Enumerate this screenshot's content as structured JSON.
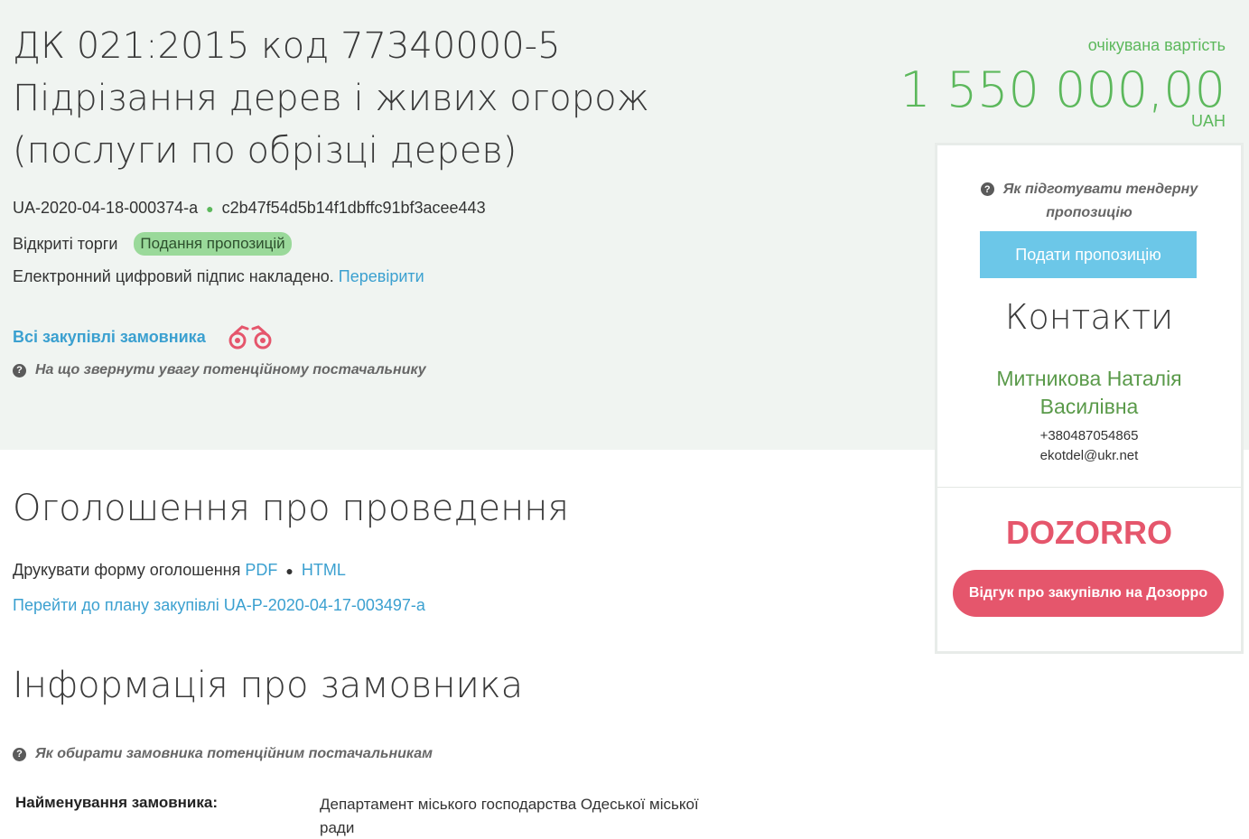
{
  "tender": {
    "title_line1": "ДК 021:2015 код 77340000-5",
    "title_line2": "Підрізання дерев і живих огорож",
    "title_line3": "(послуги по обрізці дерев)",
    "id": "UA-2020-04-18-000374-a",
    "id_separator": "●",
    "hash": "c2b47f54d5b14f1dbffc91bf3acee443",
    "procedure_type": "Відкриті торги",
    "status": "Подання пропозицій",
    "signature_text": "Електронний цифровий підпис накладено.",
    "signature_link": "Перевірити",
    "all_purchases_link": "Всі закупівлі замовника",
    "attention_help": "На що звернути увагу потенційному постачальнику"
  },
  "value": {
    "label": "очікувана вартість",
    "amount": "1 550 000,00",
    "currency": "UAH"
  },
  "sidebar": {
    "prep_help": "Як підготувати тендерну пропозицію",
    "submit_button": "Подати пропозицію",
    "contacts_title": "Контакти",
    "contact_name_line1": "Митникова Наталія",
    "contact_name_line2": "Василівна",
    "phone": "+380487054865",
    "email": "ekotdel@ukr.net",
    "dozorro_logo": "DOZORRO",
    "dozorro_button": "Відгук про закупівлю на Дозорро"
  },
  "announcement": {
    "title": "Оголошення про проведення",
    "print_label": "Друкувати форму оголошення",
    "print_pdf": "PDF",
    "print_sep": "●",
    "print_html": "HTML",
    "plan_link": "Перейти до плану закупівлі UA-P-2020-04-17-003497-a"
  },
  "customer": {
    "title": "Інформація про замовника",
    "help": "Як обирати замовника потенційним постачальникам",
    "name_label": "Найменування замовника:",
    "name_value": "Департамент міського господарства Одеської міської ради"
  },
  "colors": {
    "hero_bg": "#f0f4f1",
    "accent_green": "#5cb85c",
    "link_blue": "#3ba0d0",
    "submit_blue": "#6cc7e8",
    "dozorro_red": "#e5566c"
  }
}
